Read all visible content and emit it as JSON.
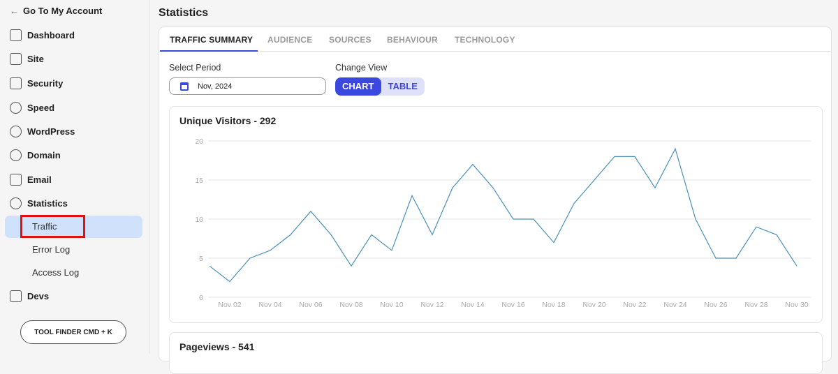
{
  "sidebar": {
    "back": "Go To My Account",
    "items": [
      {
        "label": "Dashboard",
        "icon": "grid-icon"
      },
      {
        "label": "Site",
        "icon": "site-icon"
      },
      {
        "label": "Security",
        "icon": "lock-icon"
      },
      {
        "label": "Speed",
        "icon": "rocket-icon"
      },
      {
        "label": "WordPress",
        "icon": "wordpress-icon"
      },
      {
        "label": "Domain",
        "icon": "globe-icon"
      },
      {
        "label": "Email",
        "icon": "mail-icon"
      },
      {
        "label": "Statistics",
        "icon": "pie-chart-icon"
      }
    ],
    "sub": [
      "Traffic",
      "Error Log",
      "Access Log"
    ],
    "devs": "Devs",
    "tool_finder": "TOOL FINDER CMD + K"
  },
  "page_title": "Statistics",
  "tabs": [
    "TRAFFIC SUMMARY",
    "AUDIENCE",
    "SOURCES",
    "BEHAVIOUR",
    "TECHNOLOGY"
  ],
  "controls": {
    "period_label": "Select Period",
    "period_value": "Nov, 2024",
    "view_label": "Change View",
    "chart": "CHART",
    "table": "TABLE"
  },
  "colors": {
    "accent": "#3b48e0",
    "line": "#4a90b8"
  },
  "chart_data": {
    "type": "line",
    "title": "Unique Visitors - 292",
    "x": [
      "Nov 01",
      "Nov 02",
      "Nov 03",
      "Nov 04",
      "Nov 05",
      "Nov 06",
      "Nov 07",
      "Nov 08",
      "Nov 09",
      "Nov 10",
      "Nov 11",
      "Nov 12",
      "Nov 13",
      "Nov 14",
      "Nov 15",
      "Nov 16",
      "Nov 17",
      "Nov 18",
      "Nov 19",
      "Nov 20",
      "Nov 21",
      "Nov 22",
      "Nov 23",
      "Nov 24",
      "Nov 25",
      "Nov 26",
      "Nov 27",
      "Nov 28",
      "Nov 29",
      "Nov 30"
    ],
    "values": [
      4,
      2,
      5,
      6,
      8,
      11,
      8,
      4,
      8,
      6,
      13,
      8,
      14,
      17,
      14,
      10,
      10,
      7,
      12,
      15,
      18,
      18,
      14,
      19,
      10,
      5,
      5,
      9,
      8,
      4
    ],
    "yticks": [
      "0",
      "5",
      "10",
      "15",
      "20"
    ],
    "ylim": [
      0,
      20
    ],
    "grid": true
  },
  "second_card": {
    "title": "Pageviews - 541"
  }
}
